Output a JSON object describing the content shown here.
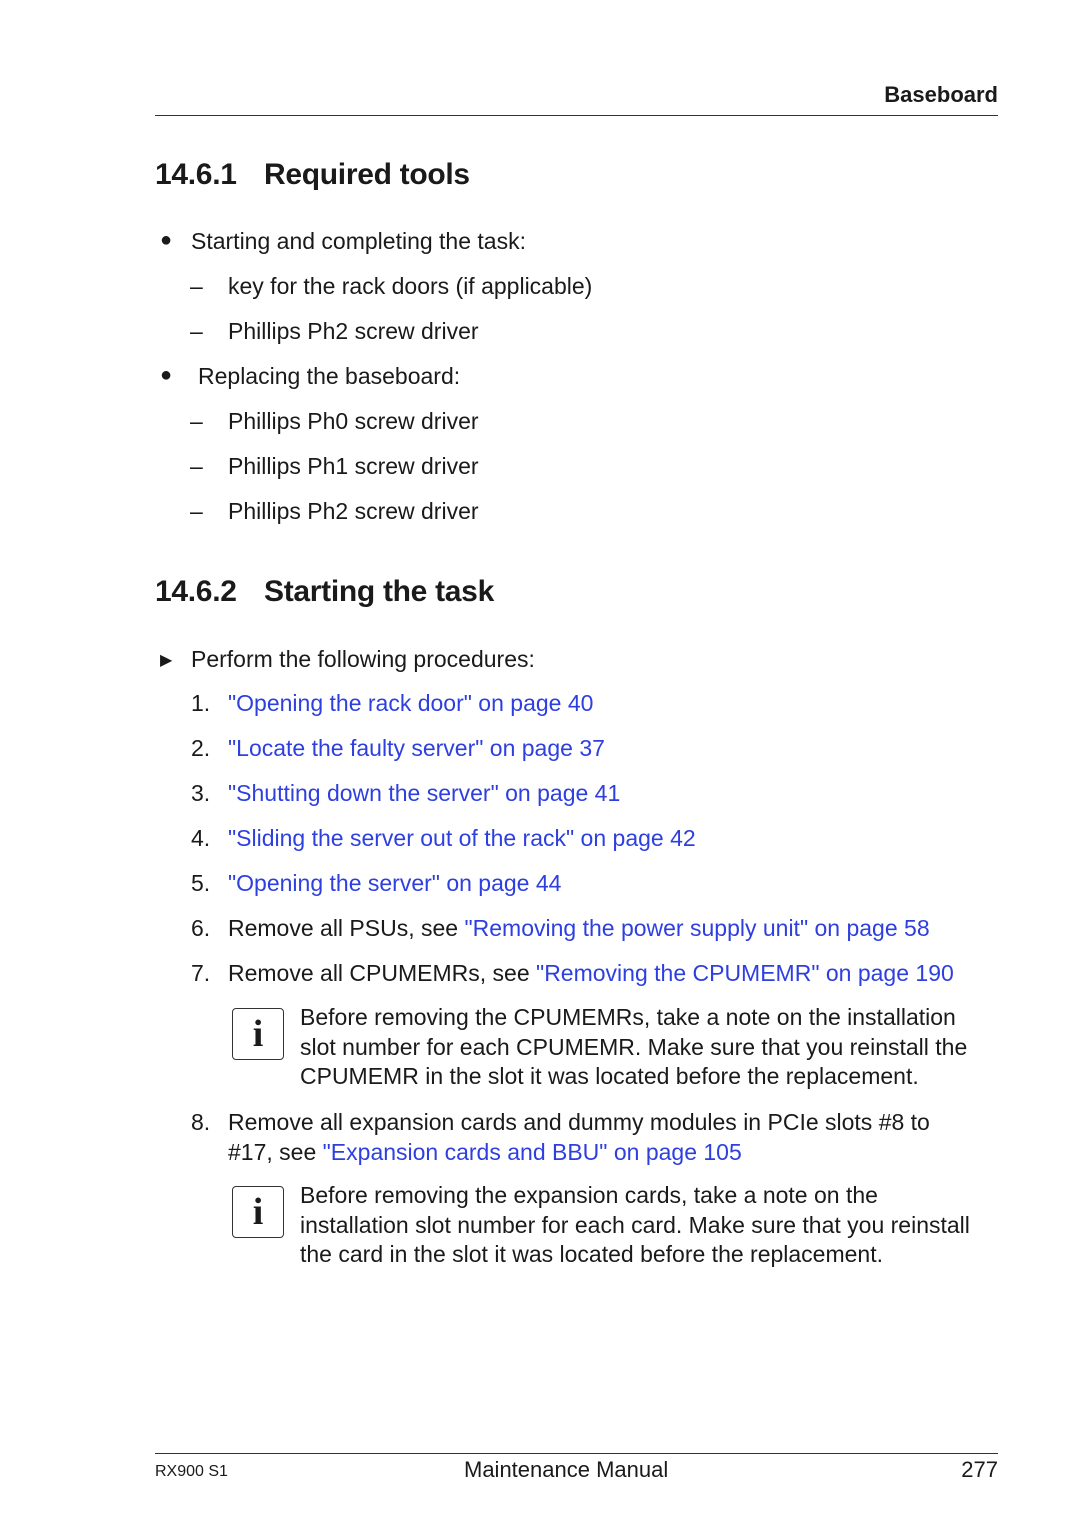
{
  "header": {
    "section": "Baseboard"
  },
  "section1": {
    "number": "14.6.1",
    "title": "Required tools",
    "groups": [
      {
        "label": "Starting and completing the task:",
        "items": [
          "key for the rack doors (if applicable)",
          "Phillips Ph2 screw driver"
        ]
      },
      {
        "label": "Replacing the baseboard:",
        "items": [
          "Phillips Ph0 screw driver",
          "Phillips Ph1 screw driver",
          "Phillips Ph2 screw driver"
        ]
      }
    ]
  },
  "section2": {
    "number": "14.6.2",
    "title": "Starting the task",
    "instruction": "Perform the following procedures:",
    "steps": [
      {
        "num": "1.",
        "prefix": "",
        "link": "\"Opening the rack door\" on page 40"
      },
      {
        "num": "2.",
        "prefix": "",
        "link": "\"Locate the faulty server\" on page 37"
      },
      {
        "num": "3.",
        "prefix": "",
        "link": "\"Shutting down the server\" on page 41"
      },
      {
        "num": "4.",
        "prefix": "",
        "link": "\"Sliding the server out of the rack\" on page 42"
      },
      {
        "num": "5.",
        "prefix": "",
        "link": "\"Opening the server\" on page 44"
      },
      {
        "num": "6.",
        "prefix": "Remove all PSUs, see ",
        "link": "\"Removing the power supply unit\" on page 58"
      },
      {
        "num": "7.",
        "prefix": "Remove all CPUMEMRs, see ",
        "link": "\"Removing the CPUMEMR\" on page 190"
      },
      {
        "num": "8.",
        "prefix_line1": "Remove all expansion cards and dummy modules in PCIe slots #8 to",
        "prefix_line2": "#17, see ",
        "link": "\"Expansion cards and BBU\" on page 105"
      }
    ],
    "notes": [
      {
        "icon": "i",
        "lines": [
          "Before removing the CPUMEMRs, take a note on the installation",
          "slot number for each CPUMEMR. Make sure that you reinstall the",
          "CPUMEMR in the slot it was located before the replacement."
        ]
      },
      {
        "icon": "i",
        "lines": [
          "Before removing the expansion cards, take a note on the",
          "installation slot number for each card. Make sure that you reinstall",
          "the card in the slot it was located before the replacement."
        ]
      }
    ]
  },
  "footer": {
    "product": "RX900 S1",
    "manual": "Maintenance Manual",
    "page": "277"
  },
  "colors": {
    "link": "#2e3fe0",
    "text": "#1a1a1a"
  }
}
